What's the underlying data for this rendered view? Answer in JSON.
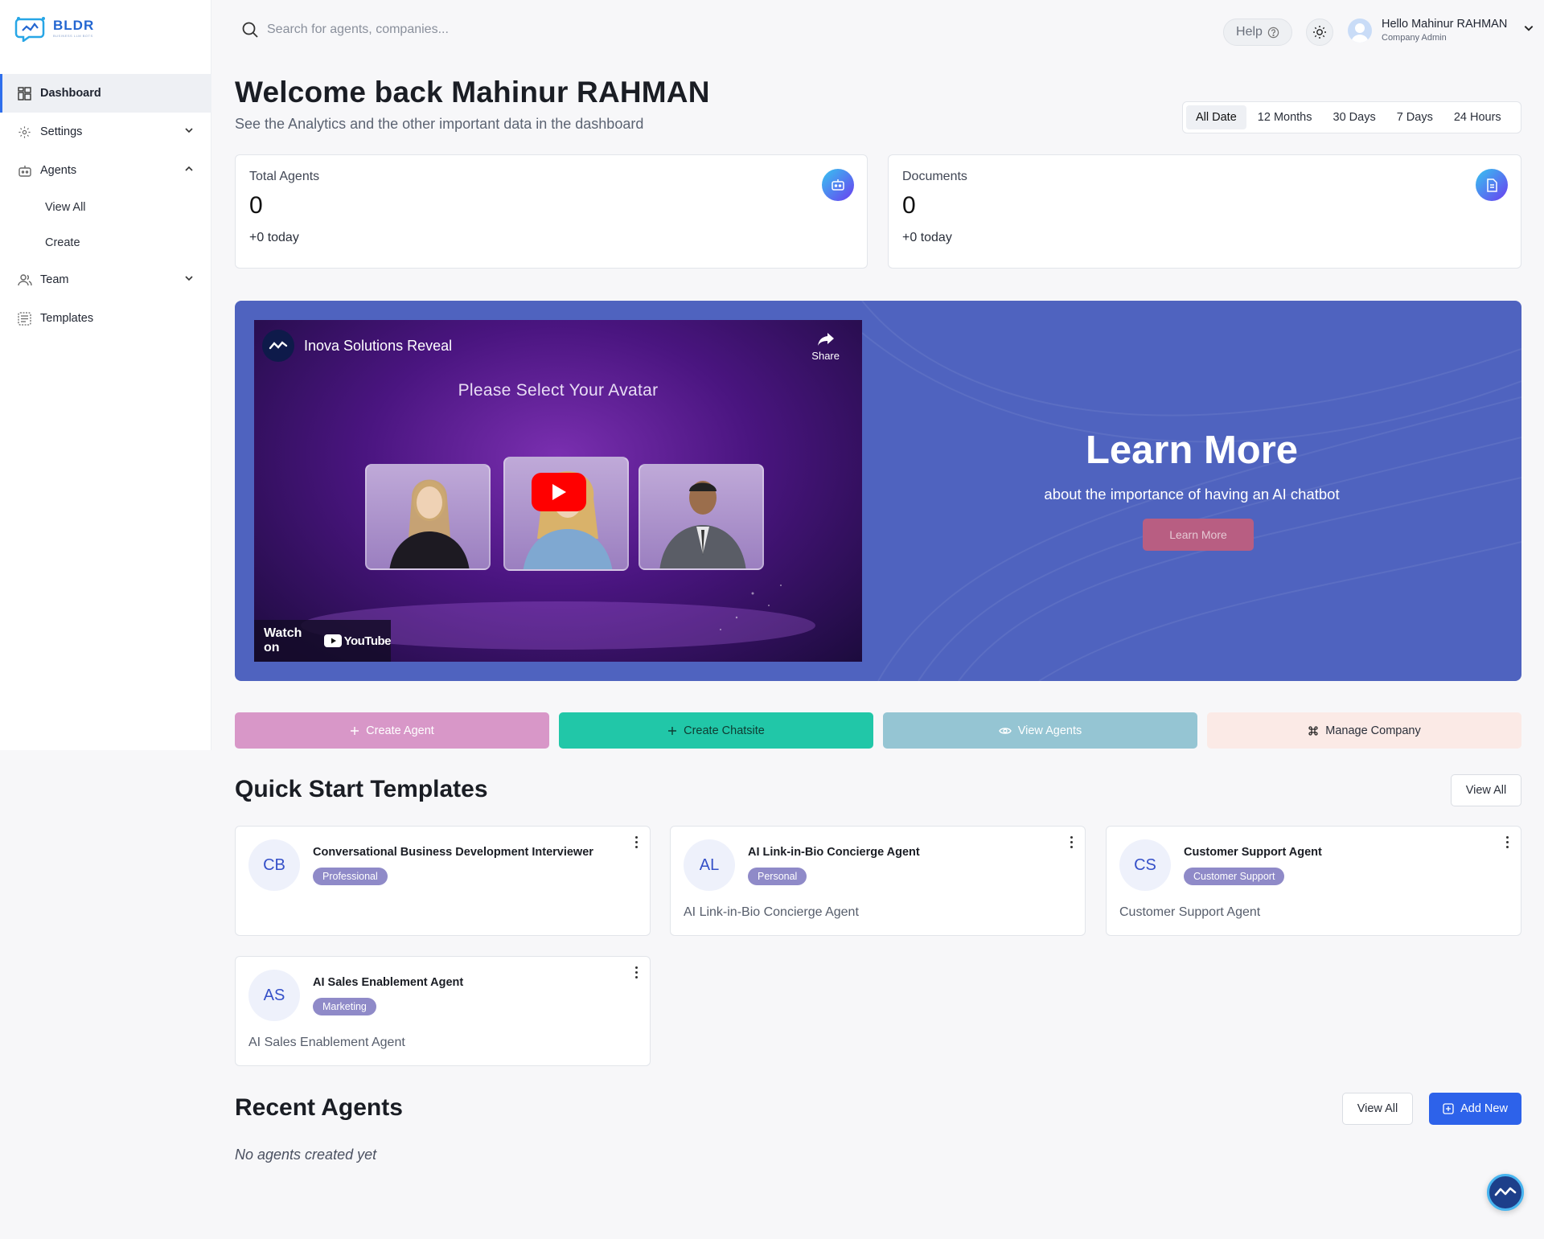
{
  "brand": {
    "name": "BLDR",
    "tagline": "BUSINESS LLM BOTS"
  },
  "sidebar": {
    "items": [
      {
        "label": "Dashboard",
        "icon": "dashboard-icon",
        "active": true
      },
      {
        "label": "Settings",
        "icon": "gear-icon",
        "expanded": false
      },
      {
        "label": "Agents",
        "icon": "robot-icon",
        "expanded": true,
        "children": [
          {
            "label": "View All"
          },
          {
            "label": "Create"
          }
        ]
      },
      {
        "label": "Team",
        "icon": "users-icon",
        "expanded": false
      },
      {
        "label": "Templates",
        "icon": "templates-icon"
      }
    ]
  },
  "topbar": {
    "search_placeholder": "Search for agents, companies...",
    "help_label": "Help",
    "user_greeting": "Hello Mahinur RAHMAN",
    "user_role": "Company Admin"
  },
  "header": {
    "title": "Welcome back Mahinur RAHMAN",
    "subtitle": "See the Analytics and the other important data in the dashboard",
    "ranges": [
      "All Date",
      "12 Months",
      "30 Days",
      "7 Days",
      "24 Hours"
    ],
    "selected_range": "All Date"
  },
  "stats": [
    {
      "label": "Total Agents",
      "value": "0",
      "delta": "+0 today",
      "icon": "robot-icon"
    },
    {
      "label": "Documents",
      "value": "0",
      "delta": "+0 today",
      "icon": "document-icon"
    }
  ],
  "banner": {
    "video": {
      "channel_title": "Inova Solutions Reveal",
      "share_label": "Share",
      "frame_text": "Please Select Your Avatar",
      "watch_on": "Watch on",
      "youtube": "YouTube"
    },
    "heading": "Learn More",
    "subheading": "about the importance of having an AI chatbot",
    "button": "Learn More"
  },
  "actions": [
    {
      "label": "Create Agent",
      "icon": "plus-icon",
      "color": "#d897c8"
    },
    {
      "label": "Create Chatsite",
      "icon": "plus-icon",
      "color": "#21c7a8"
    },
    {
      "label": "View Agents",
      "icon": "eye-icon",
      "color": "#95c5d3"
    },
    {
      "label": "Manage Company",
      "icon": "command-icon",
      "color": "#fbeae6"
    }
  ],
  "templates": {
    "title": "Quick Start Templates",
    "view_all": "View All",
    "items": [
      {
        "initials": "CB",
        "name": "Conversational Business Development Interviewer",
        "tag": "Professional",
        "description": ""
      },
      {
        "initials": "AL",
        "name": "AI Link-in-Bio Concierge Agent",
        "tag": "Personal",
        "description": "AI Link-in-Bio Concierge Agent"
      },
      {
        "initials": "CS",
        "name": "Customer Support Agent",
        "tag": "Customer Support",
        "description": "Customer Support Agent"
      },
      {
        "initials": "AS",
        "name": "AI Sales Enablement Agent",
        "tag": "Marketing",
        "description": "AI Sales Enablement Agent"
      }
    ]
  },
  "recent": {
    "title": "Recent Agents",
    "view_all": "View All",
    "add_new": "Add New",
    "empty": "No agents created yet"
  },
  "colors": {
    "accent": "#2d62ea",
    "banner": "#4f63bf",
    "tag": "#8f8ac8"
  }
}
